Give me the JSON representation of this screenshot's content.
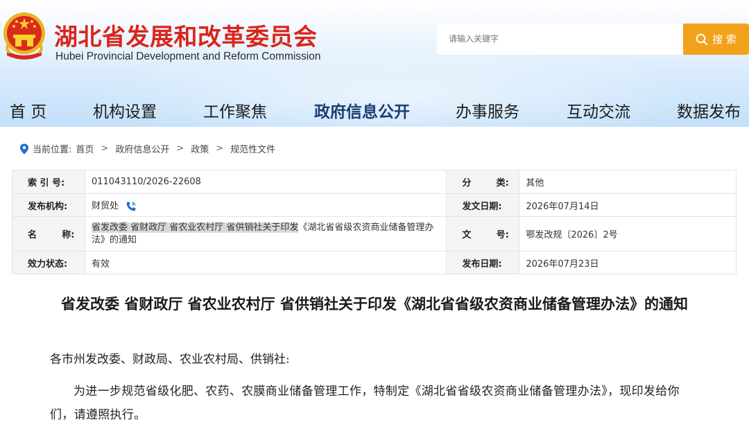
{
  "header": {
    "title": "湖北省发展和改革委员会",
    "subtitle": "Hubei Provincial Development and Reform Commission",
    "emblem_icon": "national-emblem-icon",
    "brand_color": "#d9261c"
  },
  "search": {
    "placeholder": "请输入关键字",
    "button_label": "搜 索",
    "button_icon": "search-icon",
    "button_color": "#f2a21a"
  },
  "nav": {
    "items": [
      "首 页",
      "机构设置",
      "工作聚焦",
      "政府信息公开",
      "办事服务",
      "互动交流",
      "数据发布"
    ],
    "active": "政府信息公开"
  },
  "breadcrumb": {
    "prefix": "当前位置:",
    "items": [
      "首页",
      "政府信息公开",
      "政策",
      "规范性文件"
    ],
    "separator": ">"
  },
  "info": {
    "index_label": "索 引 号:",
    "index_value": "011043110/2026-22608",
    "category_label": "分        类:",
    "category_value": "其他",
    "org_label": "发布机构:",
    "org_value": "财贸处",
    "issue_date_label": "发文日期:",
    "issue_date_value": "2026年07月14日",
    "name_label": "名        称:",
    "name_value_highlight": "省发改委 省财政厅 省农业农村厅 省供销社关于印发",
    "name_value_rest": "《湖北省省级农资商业储备管理办法》的通知",
    "doc_no_label": "文        号:",
    "doc_no_value": "鄂发改规〔2026〕2号",
    "status_label": "效力状态:",
    "status_value": "有效",
    "publish_date_label": "发布日期:",
    "publish_date_value": "2026年07月23日"
  },
  "article": {
    "title": "省发改委 省财政厅 省农业农村厅 省供销社关于印发《湖北省省级农资商业储备管理办法》的通知",
    "salutation": "各市州发改委、财政局、农业农村局、供销社:",
    "paragraph1": "为进一步规范省级化肥、农药、农膜商业储备管理工作，特制定《湖北省省级农资商业储备管理办法》，现印发给你们，请遵照执行。"
  }
}
